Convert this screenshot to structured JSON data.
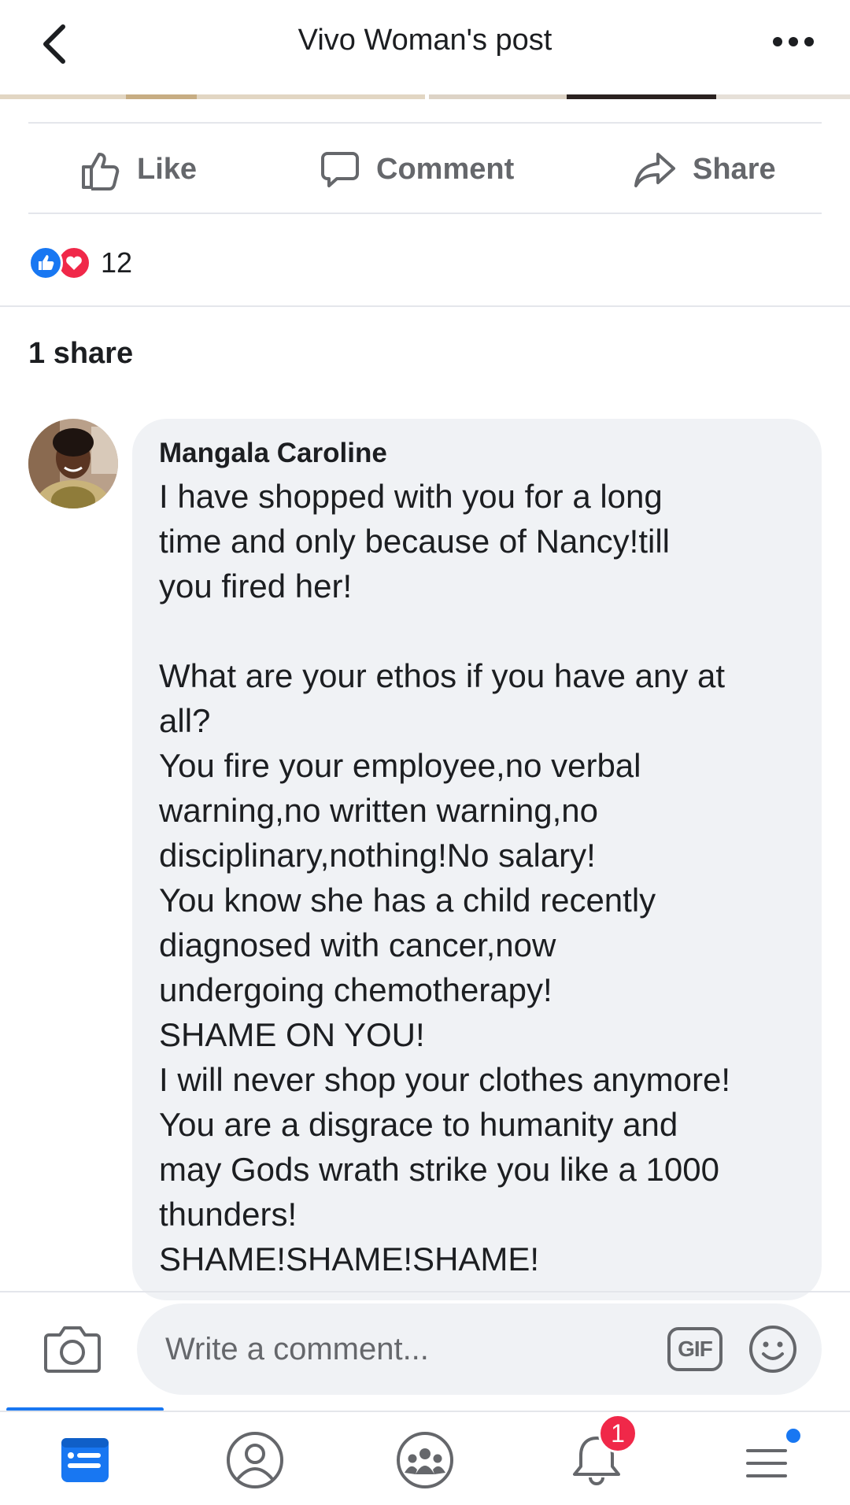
{
  "header": {
    "title": "Vivo Woman's post",
    "back_icon": "chevron-left-icon",
    "more_icon": "more-horizontal-icon"
  },
  "actions": {
    "like_label": "Like",
    "comment_label": "Comment",
    "share_label": "Share"
  },
  "reactions": {
    "types": [
      "like",
      "love"
    ],
    "count": "12"
  },
  "shares": {
    "label": "1 share"
  },
  "comment": {
    "author": "Mangala Caroline",
    "lines": [
      "I have shopped with you for a long",
      "time and only because of Nancy!till",
      "you fired her!",
      "",
      "What are your ethos if you have any at",
      "all?",
      "You fire your employee,no verbal",
      "warning,no written warning,no",
      "disciplinary,nothing!No salary!",
      "You know she has a child recently",
      "diagnosed with cancer,now",
      "undergoing chemotherapy!",
      "SHAME ON YOU!",
      "I will never shop your clothes anymore!",
      "You are a disgrace to humanity and",
      "may Gods wrath strike you like a 1000",
      "thunders!",
      "SHAME!SHAME!SHAME!"
    ]
  },
  "composer": {
    "placeholder": "Write a comment...",
    "gif_label": "GIF"
  },
  "tabbar": {
    "tabs": [
      {
        "name": "feed",
        "icon": "news-feed-icon",
        "active": true
      },
      {
        "name": "profile",
        "icon": "profile-icon",
        "active": false
      },
      {
        "name": "groups",
        "icon": "groups-icon",
        "active": false
      },
      {
        "name": "notifications",
        "icon": "bell-icon",
        "active": false,
        "badge": "1"
      },
      {
        "name": "menu",
        "icon": "menu-icon",
        "active": false
      }
    ]
  },
  "colors": {
    "accent": "#1877f2",
    "love": "#f02849",
    "muted": "#65676b",
    "bubble": "#f0f2f5"
  }
}
